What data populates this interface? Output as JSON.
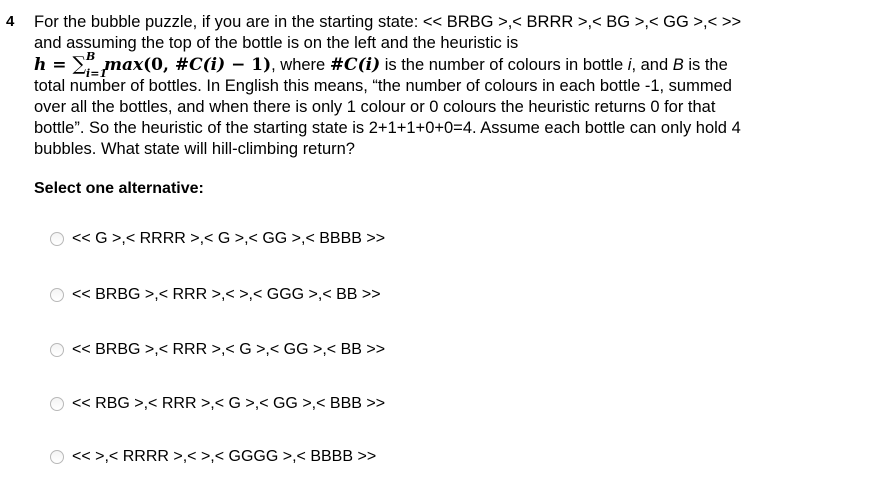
{
  "question": {
    "number": "4",
    "line1": "For the bubble puzzle, if you are in the starting state: << BRBG >,< BRRR >,< BG >,< GG >,< >>",
    "line2": "and assuming the top of the bottle is on the left and the heuristic is",
    "math": {
      "h": "h",
      "eq": " = ",
      "sigma": "∑",
      "sup": "B",
      "sub": "i=1",
      "max_fn": " max",
      "args_open": "(0, ",
      "count_fn": "#C",
      "paren_i": "(i)",
      "minus_one": " − 1)",
      "where_text": ", where ",
      "count_fn2": "#C",
      "paren_i2": "(i)",
      "desc_a": " is the number of colours in bottle ",
      "var_i": "i",
      "desc_b": ", and ",
      "var_B": "B",
      "desc_c": " is the"
    },
    "line4": "total number of bottles. In English this means, “the number of colours in each bottle -1, summed",
    "line5": "over all the bottles, and when there is only 1 colour or 0 colours the heuristic returns 0 for that",
    "line6": "bottle”. So the heuristic of the starting state is 2+1+1+0+0=4. Assume each bottle can only hold 4",
    "line7": "bubbles. What state will hill-climbing return?"
  },
  "select_label": "Select one alternative:",
  "options": [
    {
      "label": "<< G >,< RRRR >,< G >,< GG >,< BBBB >>"
    },
    {
      "label": "<< BRBG >,< RRR >,< >,< GGG >,< BB >>"
    },
    {
      "label": "<< BRBG >,< RRR >,< G >,< GG >,< BB >>"
    },
    {
      "label": "<< RBG >,< RRR >,< G >,< GG >,< BBB >>"
    },
    {
      "label": "<< >,< RRRR >,< >,< GGGG >,< BBBB >>"
    }
  ]
}
